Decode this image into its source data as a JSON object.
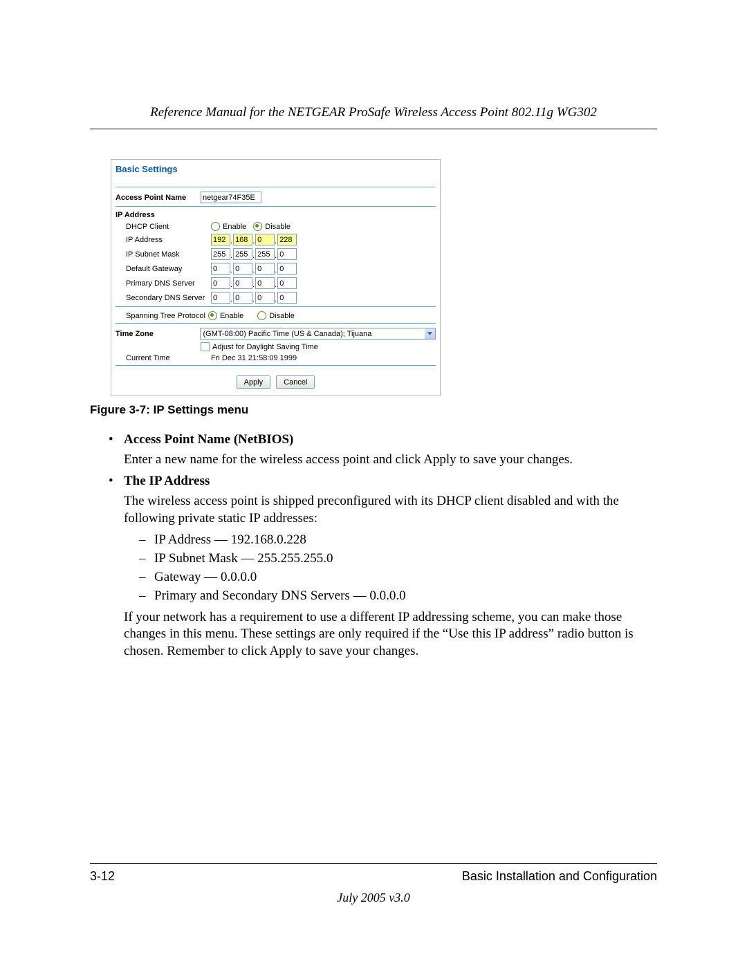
{
  "header": {
    "title": "Reference Manual for the NETGEAR ProSafe Wireless Access Point 802.11g WG302"
  },
  "ui": {
    "panel_title": "Basic Settings",
    "apn": {
      "label": "Access Point Name",
      "value": "netgear74F35E"
    },
    "ip_section": "IP Address",
    "dhcp": {
      "label": "DHCP Client",
      "enable": "Enable",
      "disable": "Disable",
      "selected": "disable"
    },
    "ip": {
      "label": "IP Address",
      "o": [
        "192",
        "168",
        "0",
        "228"
      ],
      "highlight": true
    },
    "mask": {
      "label": "IP Subnet Mask",
      "o": [
        "255",
        "255",
        "255",
        "0"
      ]
    },
    "gw": {
      "label": "Default Gateway",
      "o": [
        "0",
        "0",
        "0",
        "0"
      ]
    },
    "dns1": {
      "label": "Primary DNS Server",
      "o": [
        "0",
        "0",
        "0",
        "0"
      ]
    },
    "dns2": {
      "label": "Secondary DNS Server",
      "o": [
        "0",
        "0",
        "0",
        "0"
      ]
    },
    "stp": {
      "label": "Spanning Tree Protocol",
      "enable": "Enable",
      "disable": "Disable",
      "selected": "enable"
    },
    "tz": {
      "label": "Time Zone",
      "value": "(GMT-08:00) Pacific Time (US & Canada); Tijuana"
    },
    "dst": {
      "label": "Adjust for Daylight Saving Time"
    },
    "time": {
      "label": "Current Time",
      "value": "Fri Dec 31 21:58:09 1999"
    },
    "buttons": {
      "apply": "Apply",
      "cancel": "Cancel"
    }
  },
  "figure_caption": "Figure 3-7: IP Settings menu",
  "bullets": {
    "apn": {
      "title": "Access Point Name (NetBIOS)",
      "text": "Enter a new name for the wireless access point and click Apply to save your changes."
    },
    "ip": {
      "title": "The IP Address",
      "text1": "The wireless access point is shipped preconfigured with its DHCP client disabled and with the following private static IP addresses:",
      "items": [
        "IP Address — 192.168.0.228",
        "IP Subnet Mask — 255.255.255.0",
        "Gateway — 0.0.0.0",
        "Primary and Secondary DNS Servers — 0.0.0.0"
      ],
      "text2": "If your network has a requirement to use a different IP addressing scheme, you can make those changes in this menu. These settings are only required if the “Use this IP address” radio button is chosen. Remember to click Apply to save your changes."
    }
  },
  "footer": {
    "page_no": "3-12",
    "section": "Basic Installation and Configuration",
    "date": "July 2005 v3.0"
  }
}
